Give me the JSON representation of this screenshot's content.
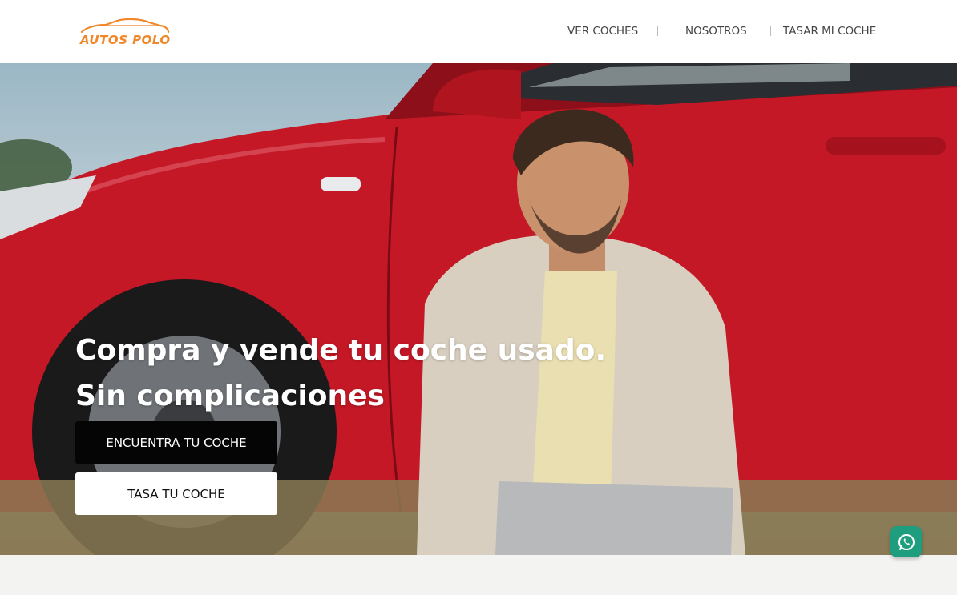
{
  "brand": {
    "name": "AUTOS POLO",
    "accent": "#f0882a"
  },
  "nav": [
    {
      "label": "VER COCHES"
    },
    {
      "label": "NOSOTROS"
    },
    {
      "label": "TASAR MI COCHE"
    }
  ],
  "hero": {
    "headline_line1": "Compra y vende tu coche usado.",
    "headline_line2": "Sin complicaciones",
    "primary_button": "ENCUENTRA TU COCHE",
    "secondary_button": "TASA TU COCHE",
    "car_color": "#c41826"
  },
  "floating": {
    "icon": "whatsapp-icon",
    "color": "#1e9e7e"
  }
}
